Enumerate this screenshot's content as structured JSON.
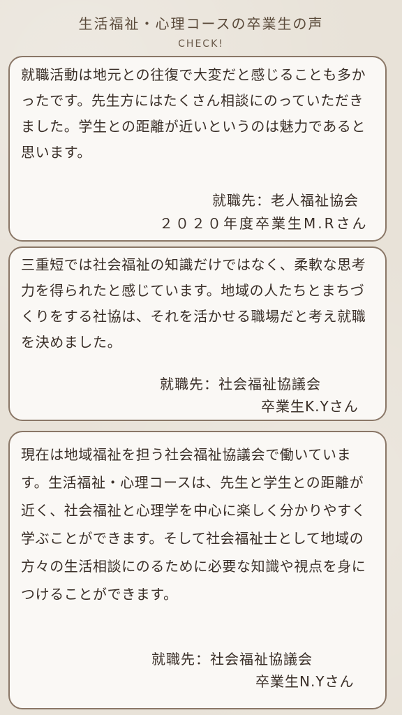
{
  "header": {
    "title": "生活福祉・心理コースの卒業生の声",
    "subtitle": "CHECK!"
  },
  "testimonials": [
    {
      "text": "就職活動は地元との往復で大変だと感じることも多かったです。先生方にはたくさん相談にのっていただきました。学生との距離が近いというのは魅力であると思います。",
      "employer": "就職先：老人福祉協会",
      "graduate": "２０２０年度卒業生M.Rさん"
    },
    {
      "text": "三重短では社会福祉の知識だけではなく、柔軟な思考力を得られたと感じています。地域の人たちとまちづくりをする社協は、それを活かせる職場だと考え就職を決めました。",
      "employer": "就職先：社会福祉協議会",
      "graduate": "卒業生K.Yさん"
    },
    {
      "text": "現在は地域福祉を担う社会福祉協議会で働いています。生活福祉・心理コースは、先生と学生との距離が近く、社会福祉と心理学を中心に楽しく分かりやすく学ぶことができます。そして社会福祉士として地域の方々の生活相談にのるために必要な知識や視点を身につけることができます。",
      "employer": "就職先：社会福祉協議会",
      "graduate": "卒業生N.Yさん"
    }
  ]
}
